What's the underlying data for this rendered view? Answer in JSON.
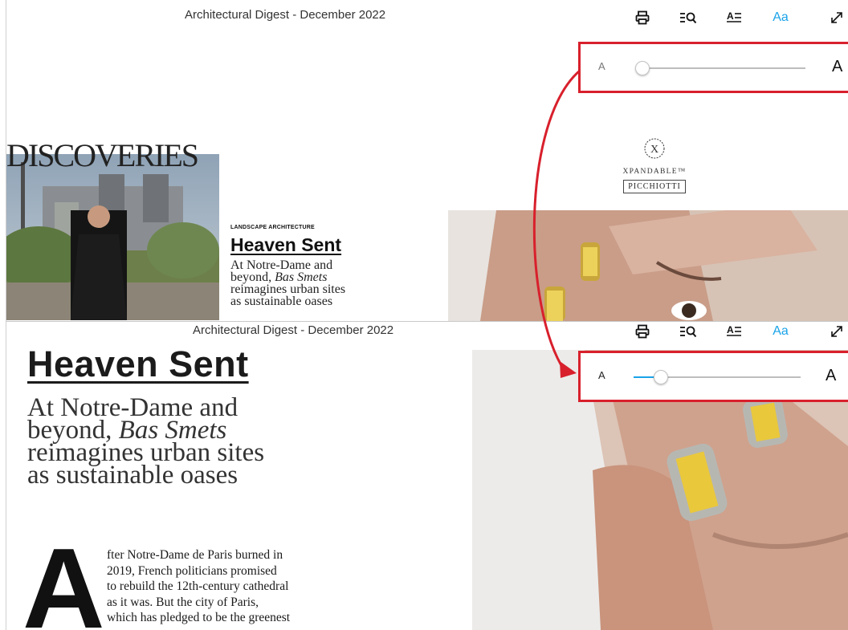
{
  "top_view": {
    "title": "Architectural Digest - December 2022",
    "font_slider": {
      "small_label": "A",
      "large_label": "A",
      "value_percent": 3
    },
    "discoveries": "DISCOVERIES",
    "kicker": "LANDSCAPE ARCHITECTURE",
    "headline": "Heaven Sent",
    "deck_lines": [
      "At Notre-Dame and",
      "beyond, ",
      "Bas Smets",
      "reimagines urban sites",
      "as sustainable oases"
    ],
    "brand": {
      "mark": "X",
      "name": "XPANDABLE™",
      "box": "PICCHIOTTI"
    }
  },
  "bottom_view": {
    "title": "Architectural Digest - December 2022",
    "font_slider": {
      "small_label": "A",
      "large_label": "A",
      "value_percent": 17
    },
    "headline": "Heaven Sent",
    "deck": {
      "line1": "At Notre-Dame and",
      "line2_prefix": "beyond, ",
      "line2_em": "Bas Smets",
      "line3": "reimagines urban sites",
      "line4": "as sustainable oases"
    },
    "drop_cap": "A",
    "body_lines": [
      "fter Notre-Dame de Paris burned in",
      "2019, French politicians promised",
      "to rebuild the 12th-century cathedral",
      "as it was. But the city of Paris,",
      "which has pledged to be the greenest"
    ]
  },
  "toolbar": {
    "print_icon": "print-icon",
    "search_icon": "text-search-icon",
    "text_view_icon": "text-view-icon",
    "font_size_label": "Aa",
    "fullscreen_icon": "expand-icon"
  },
  "colors": {
    "accent": "#1aa3e8",
    "highlight_red": "#d8202c"
  }
}
